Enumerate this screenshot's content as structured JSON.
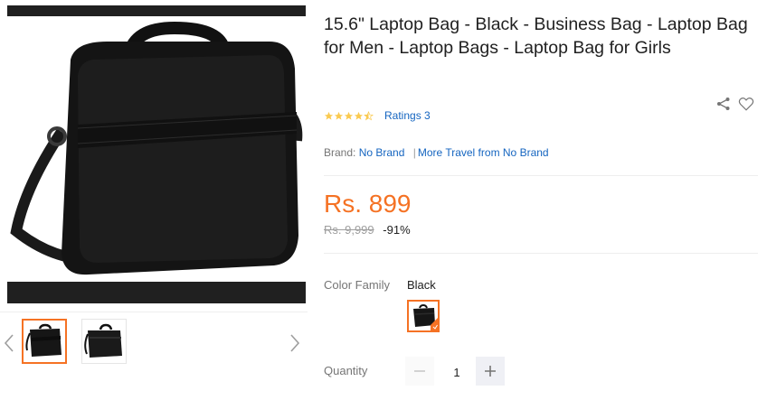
{
  "product": {
    "title": "15.6\" Laptop Bag - Black - Business Bag - Laptop Bag for Men - Laptop Bags - Laptop Bag for Girls",
    "rating_value": 4.5,
    "ratings_label": "Ratings 3",
    "brand_label": "Brand:",
    "brand_name": "No Brand",
    "brand_more": "More Travel from No Brand",
    "price": "Rs. 899",
    "original_price": "Rs. 9,999",
    "discount": "-91%",
    "color_family_label": "Color Family",
    "color_family_value": "Black",
    "quantity_label": "Quantity",
    "quantity_value": "1"
  },
  "gallery": {
    "thumbnails": [
      "laptop-bag-front",
      "laptop-bag-angled"
    ],
    "selected_index": 0
  },
  "icons": {
    "prev": "chevron-left-icon",
    "next": "chevron-right-icon",
    "share": "share-icon",
    "wishlist": "heart-icon",
    "star": "star-icon"
  },
  "colors": {
    "accent": "#f57224",
    "link": "#1565c0",
    "star": "#faca51"
  }
}
